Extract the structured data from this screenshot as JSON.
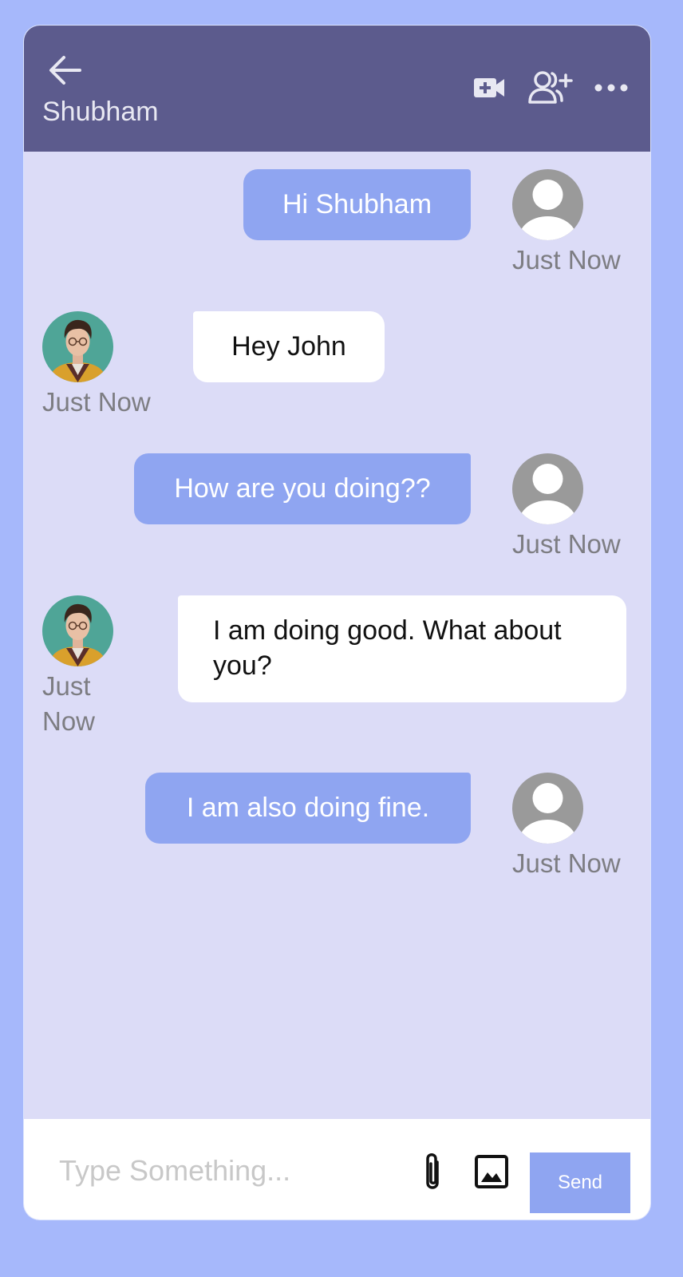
{
  "header": {
    "title": "Shubham",
    "icons": {
      "back": "arrow-left-icon",
      "video": "video-call-icon",
      "add_user": "add-user-icon",
      "more": "more-horizontal-icon"
    }
  },
  "messages": [
    {
      "direction": "outgoing",
      "text": "Hi Shubham",
      "time": "Just Now"
    },
    {
      "direction": "incoming",
      "text": "Hey John",
      "time": "Just Now"
    },
    {
      "direction": "outgoing",
      "text": "How are you doing??",
      "time": "Just Now"
    },
    {
      "direction": "incoming",
      "text": "I am doing good. What about you?",
      "time": "Just Now"
    },
    {
      "direction": "outgoing",
      "text": "I am also doing fine.",
      "time": "Just Now"
    }
  ],
  "composer": {
    "placeholder": "Type Something...",
    "value": "",
    "send_label": "Send",
    "icons": {
      "attach": "paperclip-icon",
      "image": "image-icon"
    }
  },
  "colors": {
    "page_background": "#a6b8fb",
    "chat_background": "#dcdcf7",
    "header_background": "#5c5b8d",
    "outgoing_bubble": "#8fa5f1",
    "incoming_bubble": "#ffffff",
    "send_button": "#8fa5f1"
  }
}
